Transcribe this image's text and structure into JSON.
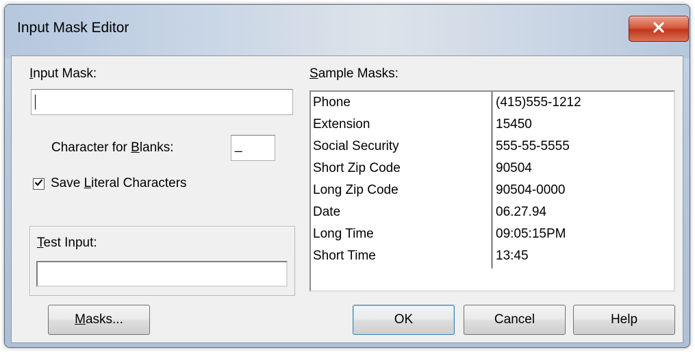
{
  "window": {
    "title": "Input Mask Editor"
  },
  "input_mask": {
    "label_prefix": "",
    "label_mnemonic": "I",
    "label_rest": "nput Mask:",
    "value": ""
  },
  "blank_char": {
    "label_prefix": "Character for ",
    "label_mnemonic": "B",
    "label_rest": "lanks:",
    "value": "_"
  },
  "save_literal": {
    "checked": true,
    "label_prefix": "Save ",
    "label_mnemonic": "L",
    "label_rest": "iteral Characters"
  },
  "test_input": {
    "label_mnemonic": "T",
    "label_rest": "est Input:",
    "value": ""
  },
  "sample_masks": {
    "label_mnemonic": "S",
    "label_rest": "ample Masks:",
    "rows": [
      {
        "name": "Phone",
        "sample": "(415)555-1212"
      },
      {
        "name": "Extension",
        "sample": "15450"
      },
      {
        "name": "Social Security",
        "sample": "555-55-5555"
      },
      {
        "name": "Short Zip Code",
        "sample": "90504"
      },
      {
        "name": "Long Zip Code",
        "sample": "90504-0000"
      },
      {
        "name": "Date",
        "sample": "06.27.94"
      },
      {
        "name": "Long Time",
        "sample": "09:05:15PM"
      },
      {
        "name": "Short Time",
        "sample": "13:45"
      }
    ]
  },
  "buttons": {
    "masks_mnemonic": "M",
    "masks_rest": "asks...",
    "ok": "OK",
    "cancel": "Cancel",
    "help": "Help"
  },
  "colors": {
    "close_button": "#c2361a",
    "dialog_face": "#f0f0f0",
    "default_button_border": "#3c7fb1"
  },
  "icons": {
    "close": "close-icon",
    "check": "checkmark-icon"
  }
}
